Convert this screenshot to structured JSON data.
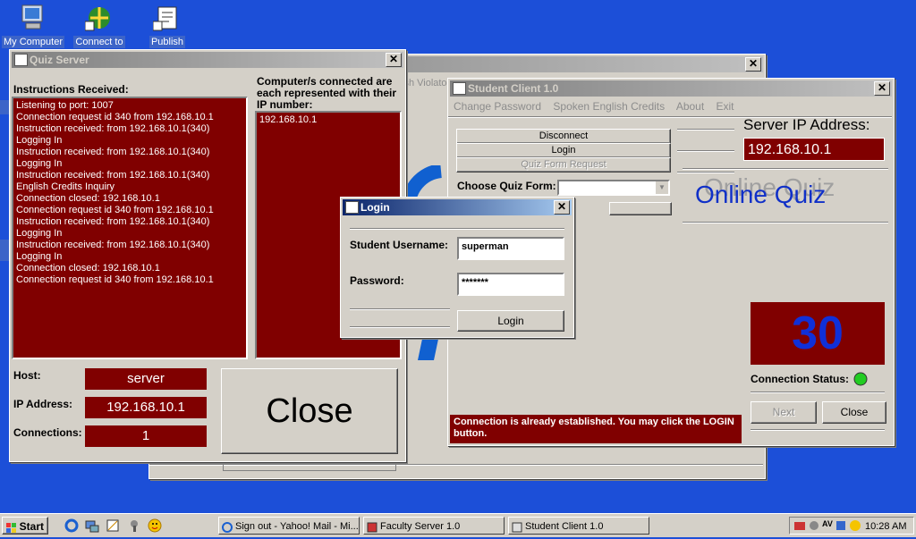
{
  "desktop": {
    "icons": [
      {
        "label": "My Computer"
      },
      {
        "label": "Connect to"
      },
      {
        "label": "Publish"
      }
    ]
  },
  "faculty_window": {
    "partial_text": "ish Violato",
    "close_glyph": "✕"
  },
  "quiz_server": {
    "title": "Quiz Server",
    "instructions_label": "Instructions Received:",
    "log": [
      "Listening to port: 1007",
      "Connection request id 340 from 192.168.10.1",
      "Instruction received:  from 192.168.10.1(340)",
      "Logging In",
      "Instruction received:  from 192.168.10.1(340)",
      "Logging In",
      "Instruction received:  from 192.168.10.1(340)",
      "English Credits Inquiry",
      "Connection closed: 192.168.10.1",
      "Connection request id 340 from 192.168.10.1",
      "Instruction received:  from 192.168.10.1(340)",
      "Logging In",
      "Instruction received:  from 192.168.10.1(340)",
      "Logging In",
      "Connection closed: 192.168.10.1",
      "Connection request id 340 from 192.168.10.1"
    ],
    "connected_label": "Computer/s connected are each represented with their IP number:",
    "connected_list": [
      "192.168.10.1"
    ],
    "host_label": "Host:",
    "host_value": "server",
    "ip_label": "IP Address:",
    "ip_value": "192.168.10.1",
    "connections_label": "Connections:",
    "connections_value": "1",
    "close_button": "Close"
  },
  "student_client": {
    "title": "Student Client 1.0",
    "menu": [
      "Change Password",
      "Spoken English Credits",
      "About",
      "Exit"
    ],
    "disconnect_button": "Disconnect",
    "login_button": "Login",
    "quiz_form_button": "Quiz Form Request",
    "choose_quiz_label": "Choose Quiz Form:",
    "server_ip_label": "Server IP Address:",
    "server_ip_value": "192.168.10.1",
    "online_quiz": "Online Quiz",
    "counter": "30",
    "connection_status_label": "Connection Status:",
    "status_color": "#22cc22",
    "next_button": "Next",
    "close_button": "Close",
    "message": "Connection is already established. You may click the LOGIN button."
  },
  "login_dialog": {
    "title": "Login",
    "username_label": "Student Username:",
    "username_value": "superman",
    "password_label": "Password:",
    "password_value": "*******",
    "login_button": "Login"
  },
  "taskbar": {
    "start": "Start",
    "tasks": [
      "Sign out - Yahoo! Mail - Mi...",
      "Faculty Server 1.0",
      "Student Client 1.0"
    ],
    "clock": "10:28 AM"
  }
}
